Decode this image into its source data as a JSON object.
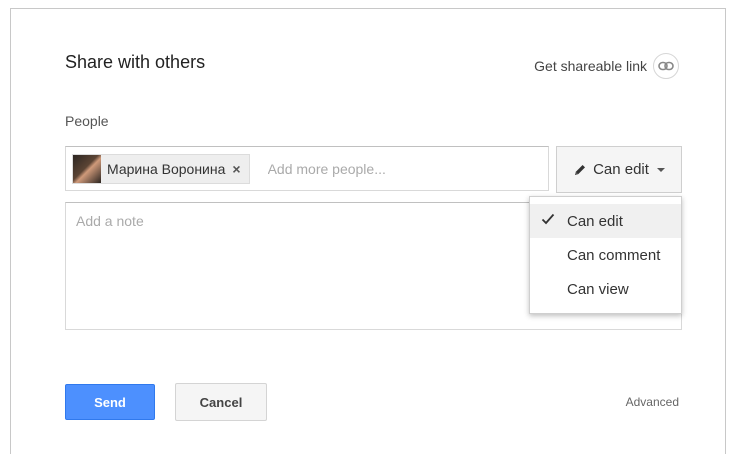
{
  "dialog": {
    "title": "Share with others",
    "shareable_link_label": "Get shareable link",
    "icons": {
      "link": "link-icon",
      "pencil": "pencil-icon",
      "check": "check-icon",
      "dropdown": "chevron-down-icon",
      "remove": "close-icon"
    }
  },
  "people": {
    "label": "People",
    "chips": [
      {
        "name": "Марина Воронина",
        "remove_glyph": "×"
      }
    ],
    "input_placeholder": "Add more people..."
  },
  "permission": {
    "selected_label": "Can edit",
    "options": [
      {
        "label": "Can edit",
        "selected": true
      },
      {
        "label": "Can comment",
        "selected": false
      },
      {
        "label": "Can view",
        "selected": false
      }
    ]
  },
  "note": {
    "placeholder": "Add a note"
  },
  "actions": {
    "send_label": "Send",
    "cancel_label": "Cancel",
    "advanced_label": "Advanced"
  },
  "colors": {
    "primary": "#4d90fe",
    "primary_border": "#3079ed"
  }
}
